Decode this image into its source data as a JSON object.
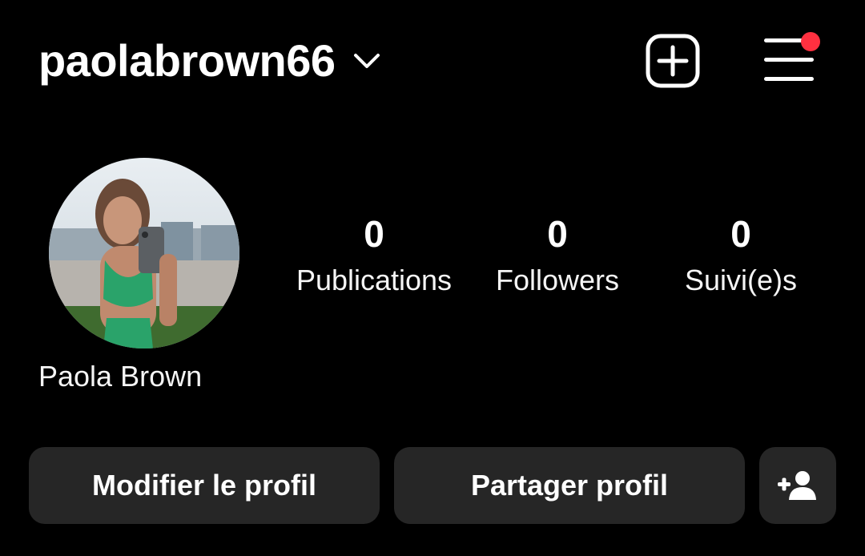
{
  "header": {
    "username": "paolabrown66",
    "icons": {
      "dropdown": "chevron-down-icon",
      "new_post": "plus-square-icon",
      "menu": "hamburger-menu-icon",
      "notification_dot_color": "#ff3040"
    }
  },
  "profile": {
    "display_name": "Paola Brown",
    "avatar": "profile-photo"
  },
  "stats": [
    {
      "value": "0",
      "label": "Publications"
    },
    {
      "value": "0",
      "label": "Followers"
    },
    {
      "value": "0",
      "label": "Suivi(e)s"
    }
  ],
  "actions": {
    "edit_label": "Modifier le profil",
    "share_label": "Partager profil",
    "add_user_icon": "person-add-icon"
  },
  "colors": {
    "background": "#000000",
    "button_bg": "#262626",
    "text": "#ffffff"
  }
}
